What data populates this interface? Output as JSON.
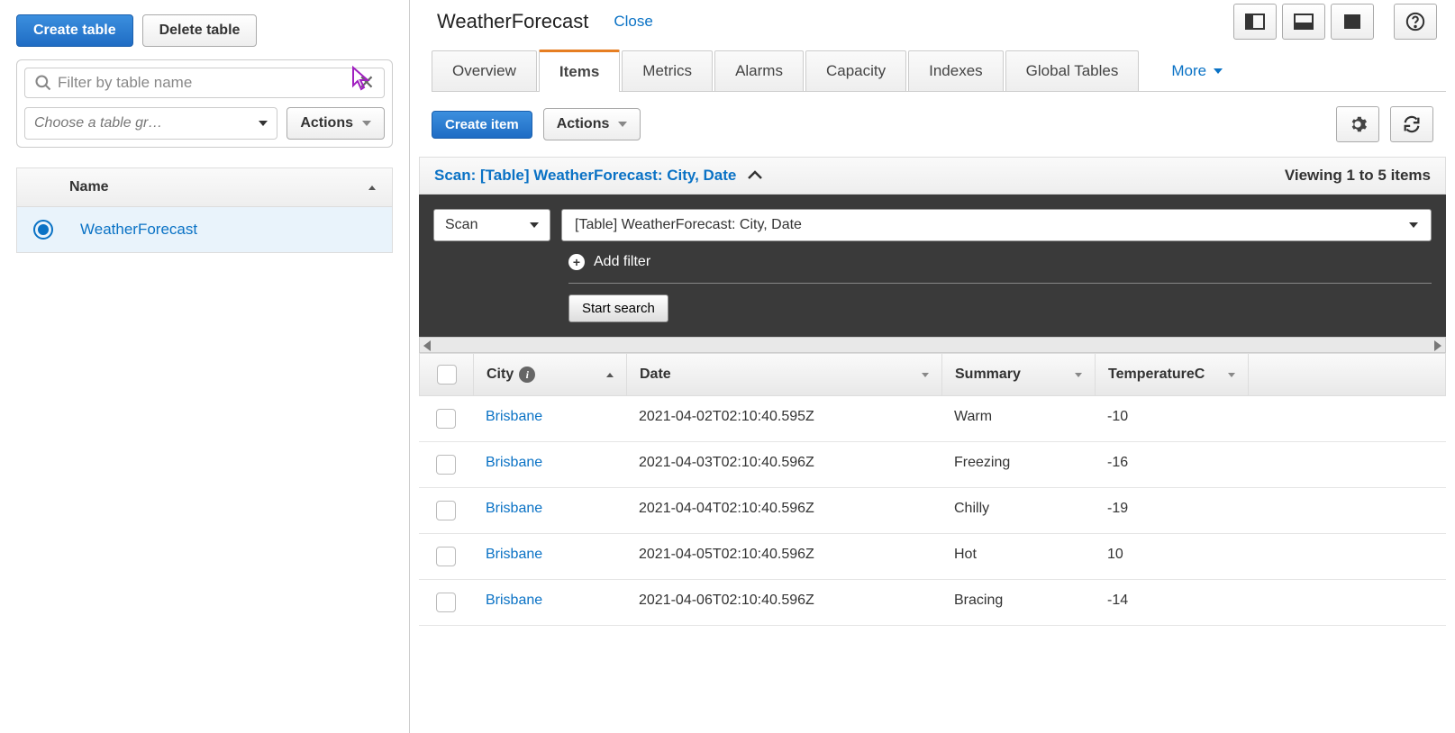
{
  "sidebar": {
    "create_table": "Create table",
    "delete_table": "Delete table",
    "filter_placeholder": "Filter by table name",
    "group_placeholder": "Choose a table gr…",
    "actions": "Actions",
    "name_header": "Name",
    "selected_table": "WeatherForecast"
  },
  "header": {
    "title": "WeatherForecast",
    "close": "Close"
  },
  "tabs": {
    "overview": "Overview",
    "items": "Items",
    "metrics": "Metrics",
    "alarms": "Alarms",
    "capacity": "Capacity",
    "indexes": "Indexes",
    "global_tables": "Global Tables",
    "more": "More"
  },
  "items_bar": {
    "create_item": "Create item",
    "actions": "Actions"
  },
  "scan": {
    "label": "Scan: [Table] WeatherForecast: City, Date",
    "viewing": "Viewing 1 to 5 items",
    "mode": "Scan",
    "target": "[Table] WeatherForecast: City, Date",
    "add_filter": "Add filter",
    "start_search": "Start search"
  },
  "columns": {
    "city": "City",
    "date": "Date",
    "summary": "Summary",
    "temp": "TemperatureC"
  },
  "rows": [
    {
      "city": "Brisbane",
      "date": "2021-04-02T02:10:40.595Z",
      "summary": "Warm",
      "temp": "-10"
    },
    {
      "city": "Brisbane",
      "date": "2021-04-03T02:10:40.596Z",
      "summary": "Freezing",
      "temp": "-16"
    },
    {
      "city": "Brisbane",
      "date": "2021-04-04T02:10:40.596Z",
      "summary": "Chilly",
      "temp": "-19"
    },
    {
      "city": "Brisbane",
      "date": "2021-04-05T02:10:40.596Z",
      "summary": "Hot",
      "temp": "10"
    },
    {
      "city": "Brisbane",
      "date": "2021-04-06T02:10:40.596Z",
      "summary": "Bracing",
      "temp": "-14"
    }
  ]
}
